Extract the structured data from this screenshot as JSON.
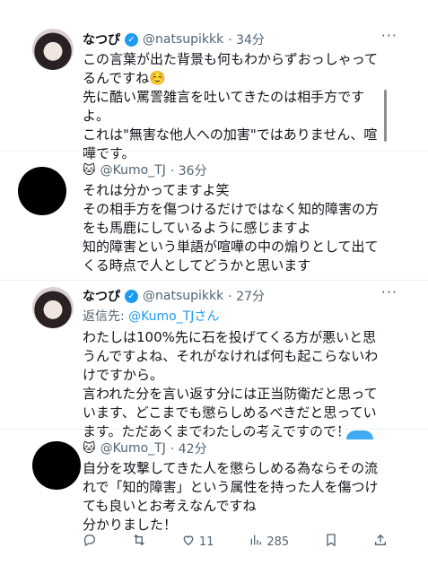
{
  "tweets": [
    {
      "name": "なつぴ",
      "handle": "@natsupikkk",
      "time": "· 34分",
      "body": "この言葉が出た背景も何もわからずおっしゃってるんですね☺️\n先に酷い罵詈雑言を吐いてきたのは相手方ですよ。\nこれは\"無害な他人への加害\"ではありません、喧嘩です。"
    },
    {
      "emoji": "🐱",
      "handle": "@Kumo_TJ",
      "time": "· 36分",
      "body": "それは分かってますよ笑\nその相手方を傷つけるだけではなく知的障害の方をも馬鹿にしているように感じますよ\n知的障害という単語が喧嘩の中の煽りとして出てくる時点で人としてどうかと思います"
    },
    {
      "name": "なつぴ",
      "handle": "@natsupikkk",
      "time": "· 27分",
      "reply_prefix": "返信先: ",
      "reply_link": "@Kumo_TJさん",
      "body": "わたしは100%先に石を投げてくる方が悪いと思うんですよね、それがなければ何も起こらないわけですから。\n言われた分を言い返す分には正当防衛だと思っています、どこまでも懲らしめるべきだと思っています。ただあくまでわたしの考えですので！"
    },
    {
      "emoji": "🐱",
      "handle": "@Kumo_TJ",
      "time": "· 42分",
      "body": "自分を攻撃してきた人を懲らしめる為ならその流れで「知的障害」という属性を持った人を傷つけても良いとお考えなんですね\n分かりました！"
    }
  ],
  "actions": {
    "likes": "11",
    "views": "285"
  },
  "icons": {
    "verified": "verified-badge-icon",
    "more": "more-options-icon",
    "reply": "reply-icon",
    "retweet": "retweet-icon",
    "like": "heart-icon",
    "views": "analytics-icon",
    "bookmark": "bookmark-icon",
    "share": "share-icon"
  },
  "colors": {
    "accent": "#1d9bf0",
    "muted": "#536471"
  }
}
